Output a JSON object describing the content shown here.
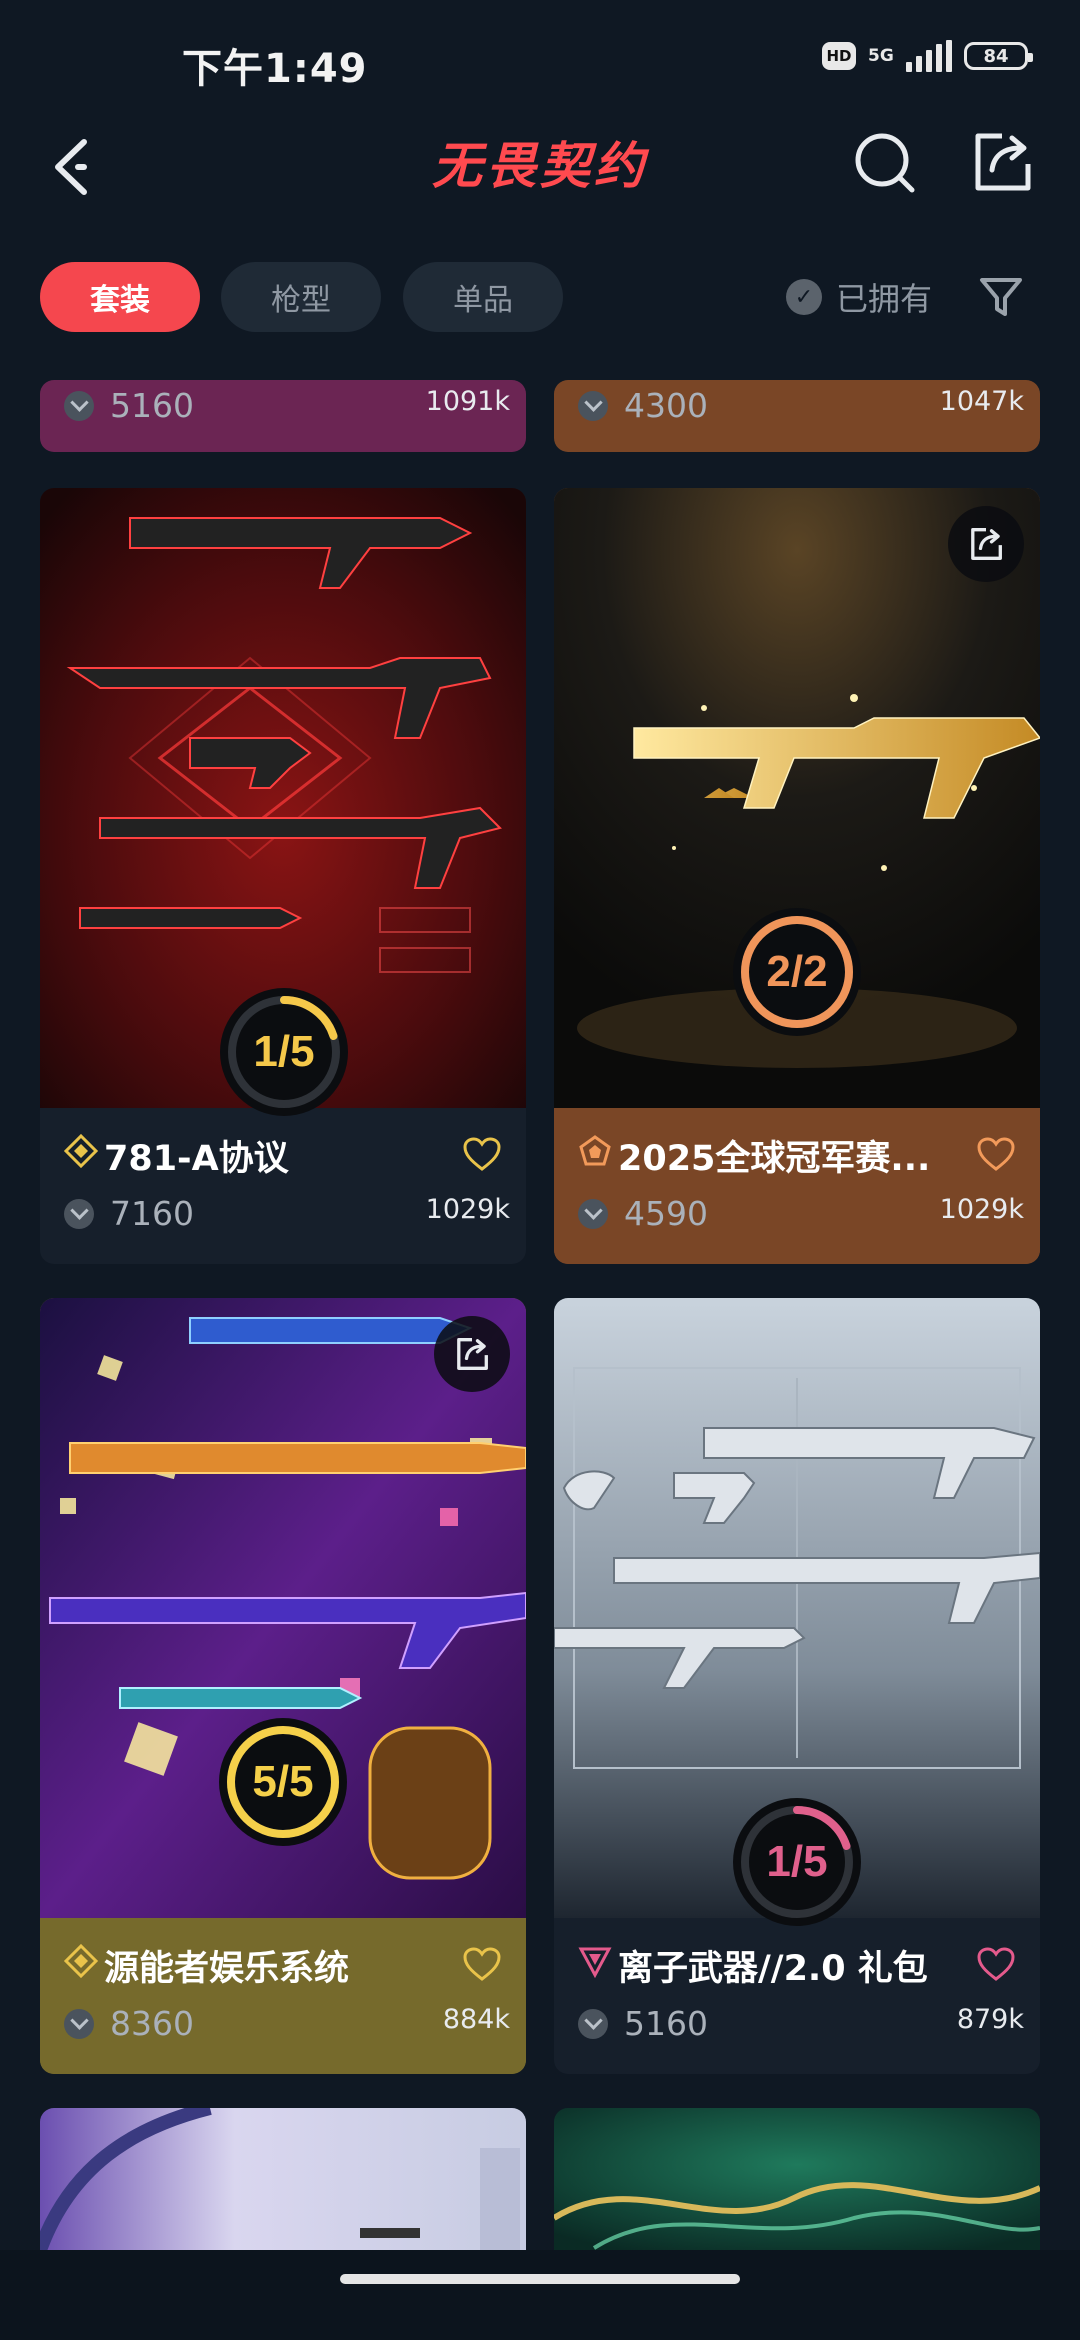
{
  "status_bar": {
    "time": "下午1:49",
    "hd": "HD",
    "network": "5G",
    "battery": "84"
  },
  "header": {
    "title": "无畏契约"
  },
  "filters": {
    "tabs": [
      "套装",
      "枪型",
      "单品"
    ],
    "owned_label": "已拥有"
  },
  "cards": [
    {
      "name": "",
      "price": "5160",
      "likes": "1091k",
      "footer_color": "#6b2553"
    },
    {
      "name": "",
      "price": "4300",
      "likes": "1047k",
      "footer_color": "#7a4626"
    },
    {
      "name": "781-A协议",
      "price": "7160",
      "likes": "1029k",
      "progress": "1/5",
      "progress_fraction": 0.2,
      "ring_color": "#f5c84a",
      "tier_color": "#e9c34a",
      "heart_color": "#e9c34a",
      "footer_color": "#161f2b"
    },
    {
      "name": "2025全球冠军赛...",
      "price": "4590",
      "likes": "1029k",
      "progress": "2/2",
      "progress_fraction": 1.0,
      "ring_color": "#f0955a",
      "tier_color": "#f29a5a",
      "heart_color": "#f29a5a",
      "footer_color": "#7a4626"
    },
    {
      "name": "源能者娱乐系统",
      "price": "8360",
      "likes": "884k",
      "progress": "5/5",
      "progress_fraction": 1.0,
      "ring_color": "#f5d04a",
      "tier_color": "#e9c34a",
      "heart_color": "#e9c34a",
      "footer_color": "#766a2c"
    },
    {
      "name": "离子武器//2.0 礼包",
      "price": "5160",
      "likes": "879k",
      "progress": "1/5",
      "progress_fraction": 0.2,
      "ring_color": "#e0608c",
      "tier_color": "#e45a8c",
      "heart_color": "#e45a8c",
      "footer_color": "#161f2b"
    }
  ]
}
